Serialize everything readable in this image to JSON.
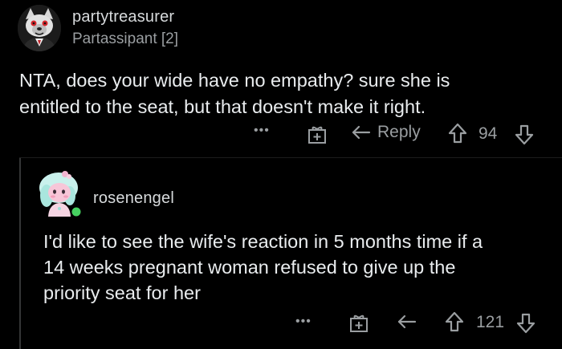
{
  "comments": [
    {
      "username": "partytreasurer",
      "flair": "Partassipant [2]",
      "text_line1": "NTA, does your wide have no empathy? sure she is",
      "text_line2": "entitled to the seat, but that doesn't make it right.",
      "actions": {
        "more": "•••",
        "reply_label": "Reply",
        "score": "94"
      }
    },
    {
      "username": "rosenengel",
      "text_line1": "I'd like to see the wife's reaction in 5 months time if a",
      "text_line2": "14 weeks pregnant woman refused to give up the",
      "text_line3": "priority seat for her",
      "actions": {
        "more": "•••",
        "score": "121"
      }
    }
  ],
  "colors": {
    "background": "#000000",
    "text": "#e9ecee",
    "muted": "#9a9ea1",
    "online": "#46d160"
  }
}
